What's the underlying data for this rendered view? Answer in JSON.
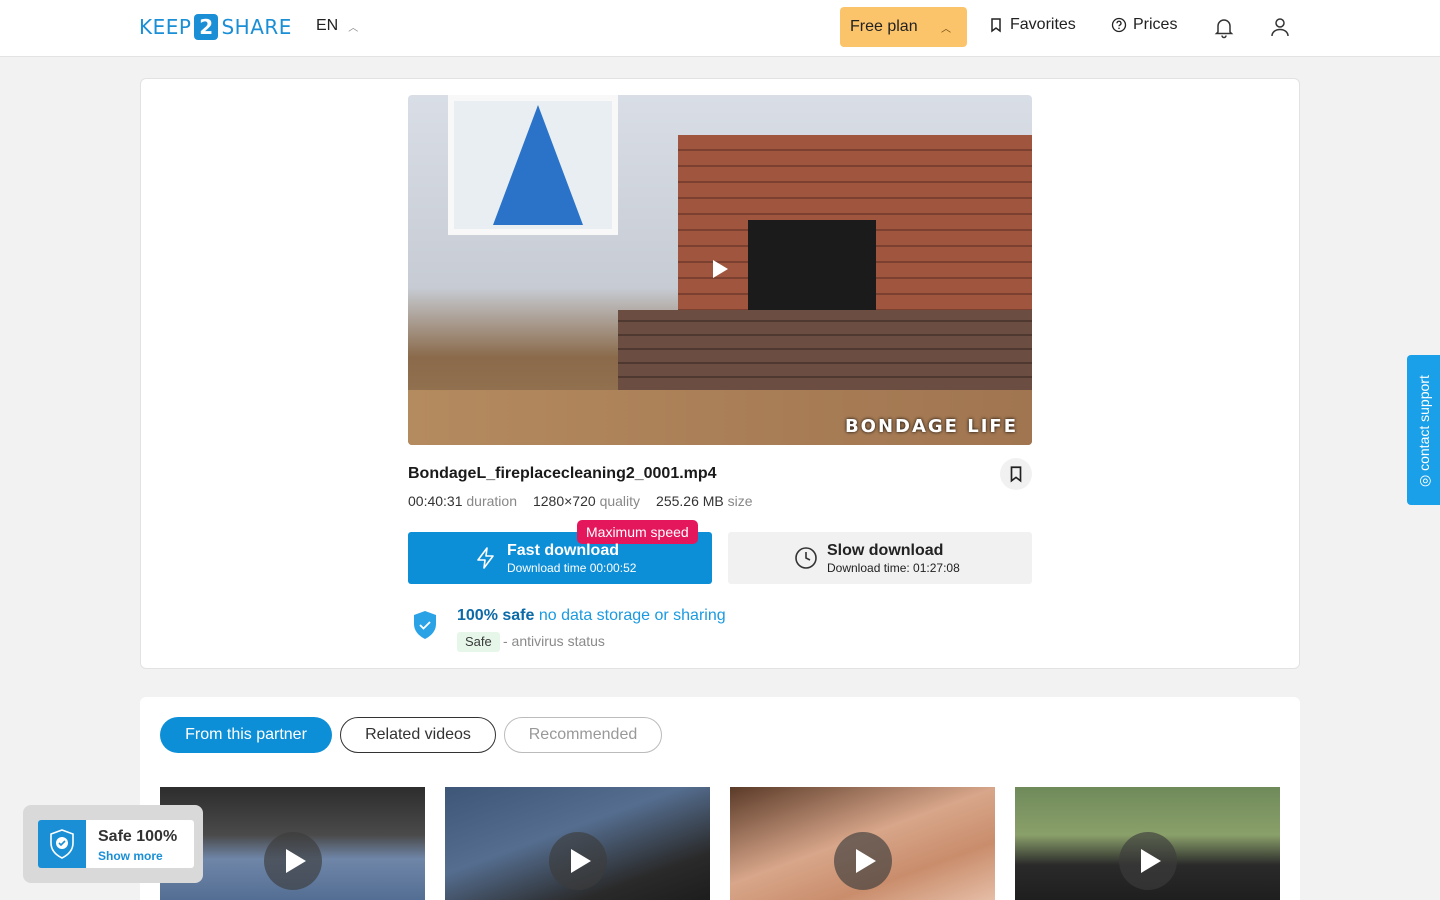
{
  "header": {
    "logo_left": "KEEP",
    "logo_mid": "2",
    "logo_right": "SHARE",
    "language": "EN",
    "plan_label": "Free plan",
    "favorites_label": "Favorites",
    "prices_label": "Prices"
  },
  "video": {
    "watermark": "BONDAGE LIFE",
    "filename": "BondageL_fireplacecleaning2_0001.mp4",
    "duration_value": "00:40:31",
    "duration_label": "duration",
    "quality_value": "1280×720",
    "quality_label": "quality",
    "size_value": "255.26 MB",
    "size_label": "size"
  },
  "download": {
    "fast_badge": "Maximum speed",
    "fast_title": "Fast download",
    "fast_sub": "Download time 00:00:52",
    "slow_title": "Slow download",
    "slow_sub": "Download time: 01:27:08"
  },
  "safety": {
    "strong": "100% safe",
    "light": "no data storage or sharing",
    "badge": "Safe",
    "status_text": "- antivirus status"
  },
  "tabs": [
    {
      "label": "From this partner",
      "state": "active"
    },
    {
      "label": "Related videos",
      "state": "outline"
    },
    {
      "label": "Recommended",
      "state": "muted"
    }
  ],
  "support_label": "◎ contact support",
  "safe_popup": {
    "title": "Safe 100%",
    "link": "Show more"
  },
  "colors": {
    "accent": "#0d8fd8",
    "plan_bg": "#fcc46a",
    "badge_red": "#e5175c"
  }
}
